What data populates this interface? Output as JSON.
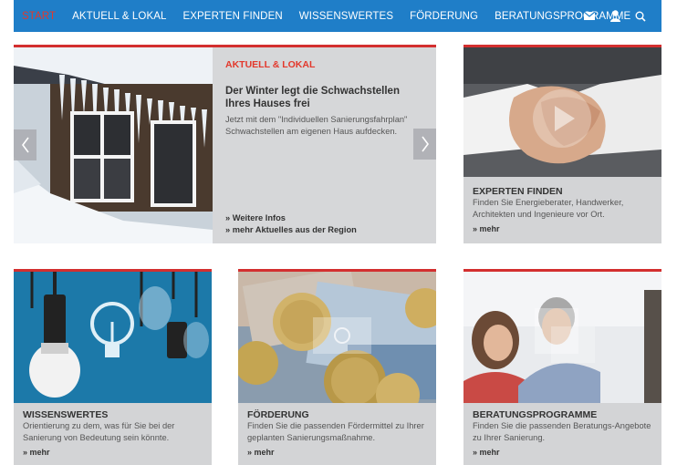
{
  "nav": {
    "items": [
      "START",
      "AKTUELL & LOKAL",
      "EXPERTEN FINDEN",
      "WISSENSWERTES",
      "FÖRDERUNG",
      "BERATUNGSPROGRAMME"
    ],
    "active_color": "#e3382c",
    "bg_color": "#1f7ec8",
    "icons": [
      "mail-icon",
      "user-icon",
      "search-icon"
    ]
  },
  "hero": {
    "category": "AKTUELL & LOKAL",
    "title": "Der Winter legt die Schwachstellen Ihres Hauses frei",
    "text": "Jetzt mit dem \"Individuellen Sanierungsfahrplan\" Schwachstellen am eigenen Haus aufdecken.",
    "link1": "» Weitere Infos",
    "link2": "» mehr Aktuelles aus der Region"
  },
  "cards": {
    "experten": {
      "title": "EXPERTEN FINDEN",
      "text": "Finden Sie Energieberater, Handwerker, Architekten und Ingenieure vor Ort.",
      "more": "» mehr"
    },
    "wissen": {
      "title": "WISSENSWERTES",
      "text": "Orientierung zu dem, was für Sie bei der Sanierung von Bedeutung sein könnte.",
      "more": "» mehr"
    },
    "foerderung": {
      "title": "FÖRDERUNG",
      "text": "Finden Sie die passenden Fördermittel zu Ihrer geplanten Sanierungsmaßnahme.",
      "more": "» mehr"
    },
    "beratung": {
      "title": "BERATUNGSPROGRAMME",
      "text": "Finden Sie die passenden Beratungs-Angebote zu Ihrer Sanierung.",
      "more": "» mehr"
    }
  },
  "colors": {
    "accent_red": "#d32f2f",
    "card_bg": "#d3d4d6"
  }
}
